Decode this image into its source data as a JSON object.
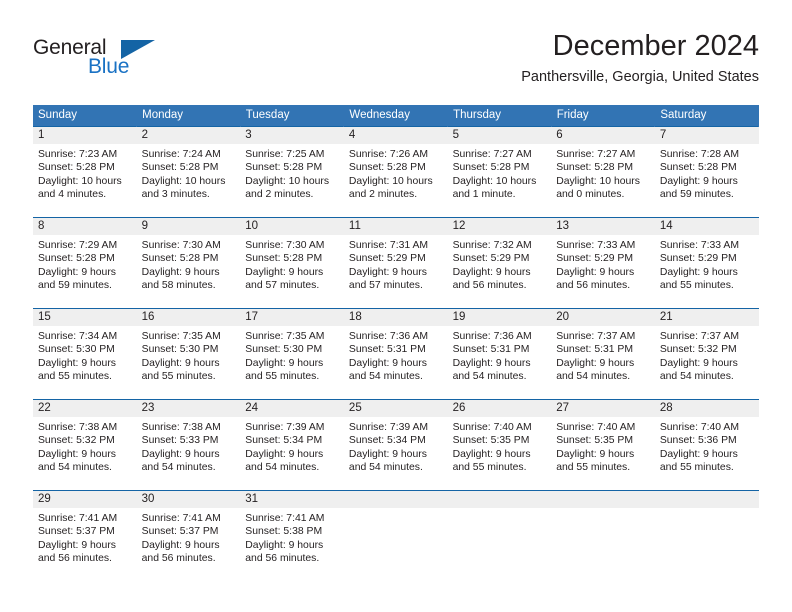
{
  "logo": {
    "word_one": "General",
    "word_two": "Blue",
    "triangle_icon": "triangle-icon",
    "brand_dark": "#231f20",
    "brand_blue": "#1a72c4",
    "triangle_blue": "#1464a5"
  },
  "header": {
    "title": "December 2024",
    "subtitle": "Panthersville, Georgia, United States"
  },
  "theme": {
    "header_bg": "#3274b4",
    "header_text": "#ffffff",
    "daynum_band_bg": "#efefef",
    "row_divider": "#1464a5",
    "body_text": "#231f20"
  },
  "weekdays": [
    "Sunday",
    "Monday",
    "Tuesday",
    "Wednesday",
    "Thursday",
    "Friday",
    "Saturday"
  ],
  "weeks": [
    [
      {
        "day": "1",
        "sunrise": "Sunrise: 7:23 AM",
        "sunset": "Sunset: 5:28 PM",
        "daylight_line1": "Daylight: 10 hours",
        "daylight_line2": "and 4 minutes."
      },
      {
        "day": "2",
        "sunrise": "Sunrise: 7:24 AM",
        "sunset": "Sunset: 5:28 PM",
        "daylight_line1": "Daylight: 10 hours",
        "daylight_line2": "and 3 minutes."
      },
      {
        "day": "3",
        "sunrise": "Sunrise: 7:25 AM",
        "sunset": "Sunset: 5:28 PM",
        "daylight_line1": "Daylight: 10 hours",
        "daylight_line2": "and 2 minutes."
      },
      {
        "day": "4",
        "sunrise": "Sunrise: 7:26 AM",
        "sunset": "Sunset: 5:28 PM",
        "daylight_line1": "Daylight: 10 hours",
        "daylight_line2": "and 2 minutes."
      },
      {
        "day": "5",
        "sunrise": "Sunrise: 7:27 AM",
        "sunset": "Sunset: 5:28 PM",
        "daylight_line1": "Daylight: 10 hours",
        "daylight_line2": "and 1 minute."
      },
      {
        "day": "6",
        "sunrise": "Sunrise: 7:27 AM",
        "sunset": "Sunset: 5:28 PM",
        "daylight_line1": "Daylight: 10 hours",
        "daylight_line2": "and 0 minutes."
      },
      {
        "day": "7",
        "sunrise": "Sunrise: 7:28 AM",
        "sunset": "Sunset: 5:28 PM",
        "daylight_line1": "Daylight: 9 hours",
        "daylight_line2": "and 59 minutes."
      }
    ],
    [
      {
        "day": "8",
        "sunrise": "Sunrise: 7:29 AM",
        "sunset": "Sunset: 5:28 PM",
        "daylight_line1": "Daylight: 9 hours",
        "daylight_line2": "and 59 minutes."
      },
      {
        "day": "9",
        "sunrise": "Sunrise: 7:30 AM",
        "sunset": "Sunset: 5:28 PM",
        "daylight_line1": "Daylight: 9 hours",
        "daylight_line2": "and 58 minutes."
      },
      {
        "day": "10",
        "sunrise": "Sunrise: 7:30 AM",
        "sunset": "Sunset: 5:28 PM",
        "daylight_line1": "Daylight: 9 hours",
        "daylight_line2": "and 57 minutes."
      },
      {
        "day": "11",
        "sunrise": "Sunrise: 7:31 AM",
        "sunset": "Sunset: 5:29 PM",
        "daylight_line1": "Daylight: 9 hours",
        "daylight_line2": "and 57 minutes."
      },
      {
        "day": "12",
        "sunrise": "Sunrise: 7:32 AM",
        "sunset": "Sunset: 5:29 PM",
        "daylight_line1": "Daylight: 9 hours",
        "daylight_line2": "and 56 minutes."
      },
      {
        "day": "13",
        "sunrise": "Sunrise: 7:33 AM",
        "sunset": "Sunset: 5:29 PM",
        "daylight_line1": "Daylight: 9 hours",
        "daylight_line2": "and 56 minutes."
      },
      {
        "day": "14",
        "sunrise": "Sunrise: 7:33 AM",
        "sunset": "Sunset: 5:29 PM",
        "daylight_line1": "Daylight: 9 hours",
        "daylight_line2": "and 55 minutes."
      }
    ],
    [
      {
        "day": "15",
        "sunrise": "Sunrise: 7:34 AM",
        "sunset": "Sunset: 5:30 PM",
        "daylight_line1": "Daylight: 9 hours",
        "daylight_line2": "and 55 minutes."
      },
      {
        "day": "16",
        "sunrise": "Sunrise: 7:35 AM",
        "sunset": "Sunset: 5:30 PM",
        "daylight_line1": "Daylight: 9 hours",
        "daylight_line2": "and 55 minutes."
      },
      {
        "day": "17",
        "sunrise": "Sunrise: 7:35 AM",
        "sunset": "Sunset: 5:30 PM",
        "daylight_line1": "Daylight: 9 hours",
        "daylight_line2": "and 55 minutes."
      },
      {
        "day": "18",
        "sunrise": "Sunrise: 7:36 AM",
        "sunset": "Sunset: 5:31 PM",
        "daylight_line1": "Daylight: 9 hours",
        "daylight_line2": "and 54 minutes."
      },
      {
        "day": "19",
        "sunrise": "Sunrise: 7:36 AM",
        "sunset": "Sunset: 5:31 PM",
        "daylight_line1": "Daylight: 9 hours",
        "daylight_line2": "and 54 minutes."
      },
      {
        "day": "20",
        "sunrise": "Sunrise: 7:37 AM",
        "sunset": "Sunset: 5:31 PM",
        "daylight_line1": "Daylight: 9 hours",
        "daylight_line2": "and 54 minutes."
      },
      {
        "day": "21",
        "sunrise": "Sunrise: 7:37 AM",
        "sunset": "Sunset: 5:32 PM",
        "daylight_line1": "Daylight: 9 hours",
        "daylight_line2": "and 54 minutes."
      }
    ],
    [
      {
        "day": "22",
        "sunrise": "Sunrise: 7:38 AM",
        "sunset": "Sunset: 5:32 PM",
        "daylight_line1": "Daylight: 9 hours",
        "daylight_line2": "and 54 minutes."
      },
      {
        "day": "23",
        "sunrise": "Sunrise: 7:38 AM",
        "sunset": "Sunset: 5:33 PM",
        "daylight_line1": "Daylight: 9 hours",
        "daylight_line2": "and 54 minutes."
      },
      {
        "day": "24",
        "sunrise": "Sunrise: 7:39 AM",
        "sunset": "Sunset: 5:34 PM",
        "daylight_line1": "Daylight: 9 hours",
        "daylight_line2": "and 54 minutes."
      },
      {
        "day": "25",
        "sunrise": "Sunrise: 7:39 AM",
        "sunset": "Sunset: 5:34 PM",
        "daylight_line1": "Daylight: 9 hours",
        "daylight_line2": "and 54 minutes."
      },
      {
        "day": "26",
        "sunrise": "Sunrise: 7:40 AM",
        "sunset": "Sunset: 5:35 PM",
        "daylight_line1": "Daylight: 9 hours",
        "daylight_line2": "and 55 minutes."
      },
      {
        "day": "27",
        "sunrise": "Sunrise: 7:40 AM",
        "sunset": "Sunset: 5:35 PM",
        "daylight_line1": "Daylight: 9 hours",
        "daylight_line2": "and 55 minutes."
      },
      {
        "day": "28",
        "sunrise": "Sunrise: 7:40 AM",
        "sunset": "Sunset: 5:36 PM",
        "daylight_line1": "Daylight: 9 hours",
        "daylight_line2": "and 55 minutes."
      }
    ],
    [
      {
        "day": "29",
        "sunrise": "Sunrise: 7:41 AM",
        "sunset": "Sunset: 5:37 PM",
        "daylight_line1": "Daylight: 9 hours",
        "daylight_line2": "and 56 minutes."
      },
      {
        "day": "30",
        "sunrise": "Sunrise: 7:41 AM",
        "sunset": "Sunset: 5:37 PM",
        "daylight_line1": "Daylight: 9 hours",
        "daylight_line2": "and 56 minutes."
      },
      {
        "day": "31",
        "sunrise": "Sunrise: 7:41 AM",
        "sunset": "Sunset: 5:38 PM",
        "daylight_line1": "Daylight: 9 hours",
        "daylight_line2": "and 56 minutes."
      },
      {
        "day": "",
        "sunrise": "",
        "sunset": "",
        "daylight_line1": "",
        "daylight_line2": ""
      },
      {
        "day": "",
        "sunrise": "",
        "sunset": "",
        "daylight_line1": "",
        "daylight_line2": ""
      },
      {
        "day": "",
        "sunrise": "",
        "sunset": "",
        "daylight_line1": "",
        "daylight_line2": ""
      },
      {
        "day": "",
        "sunrise": "",
        "sunset": "",
        "daylight_line1": "",
        "daylight_line2": ""
      }
    ]
  ]
}
